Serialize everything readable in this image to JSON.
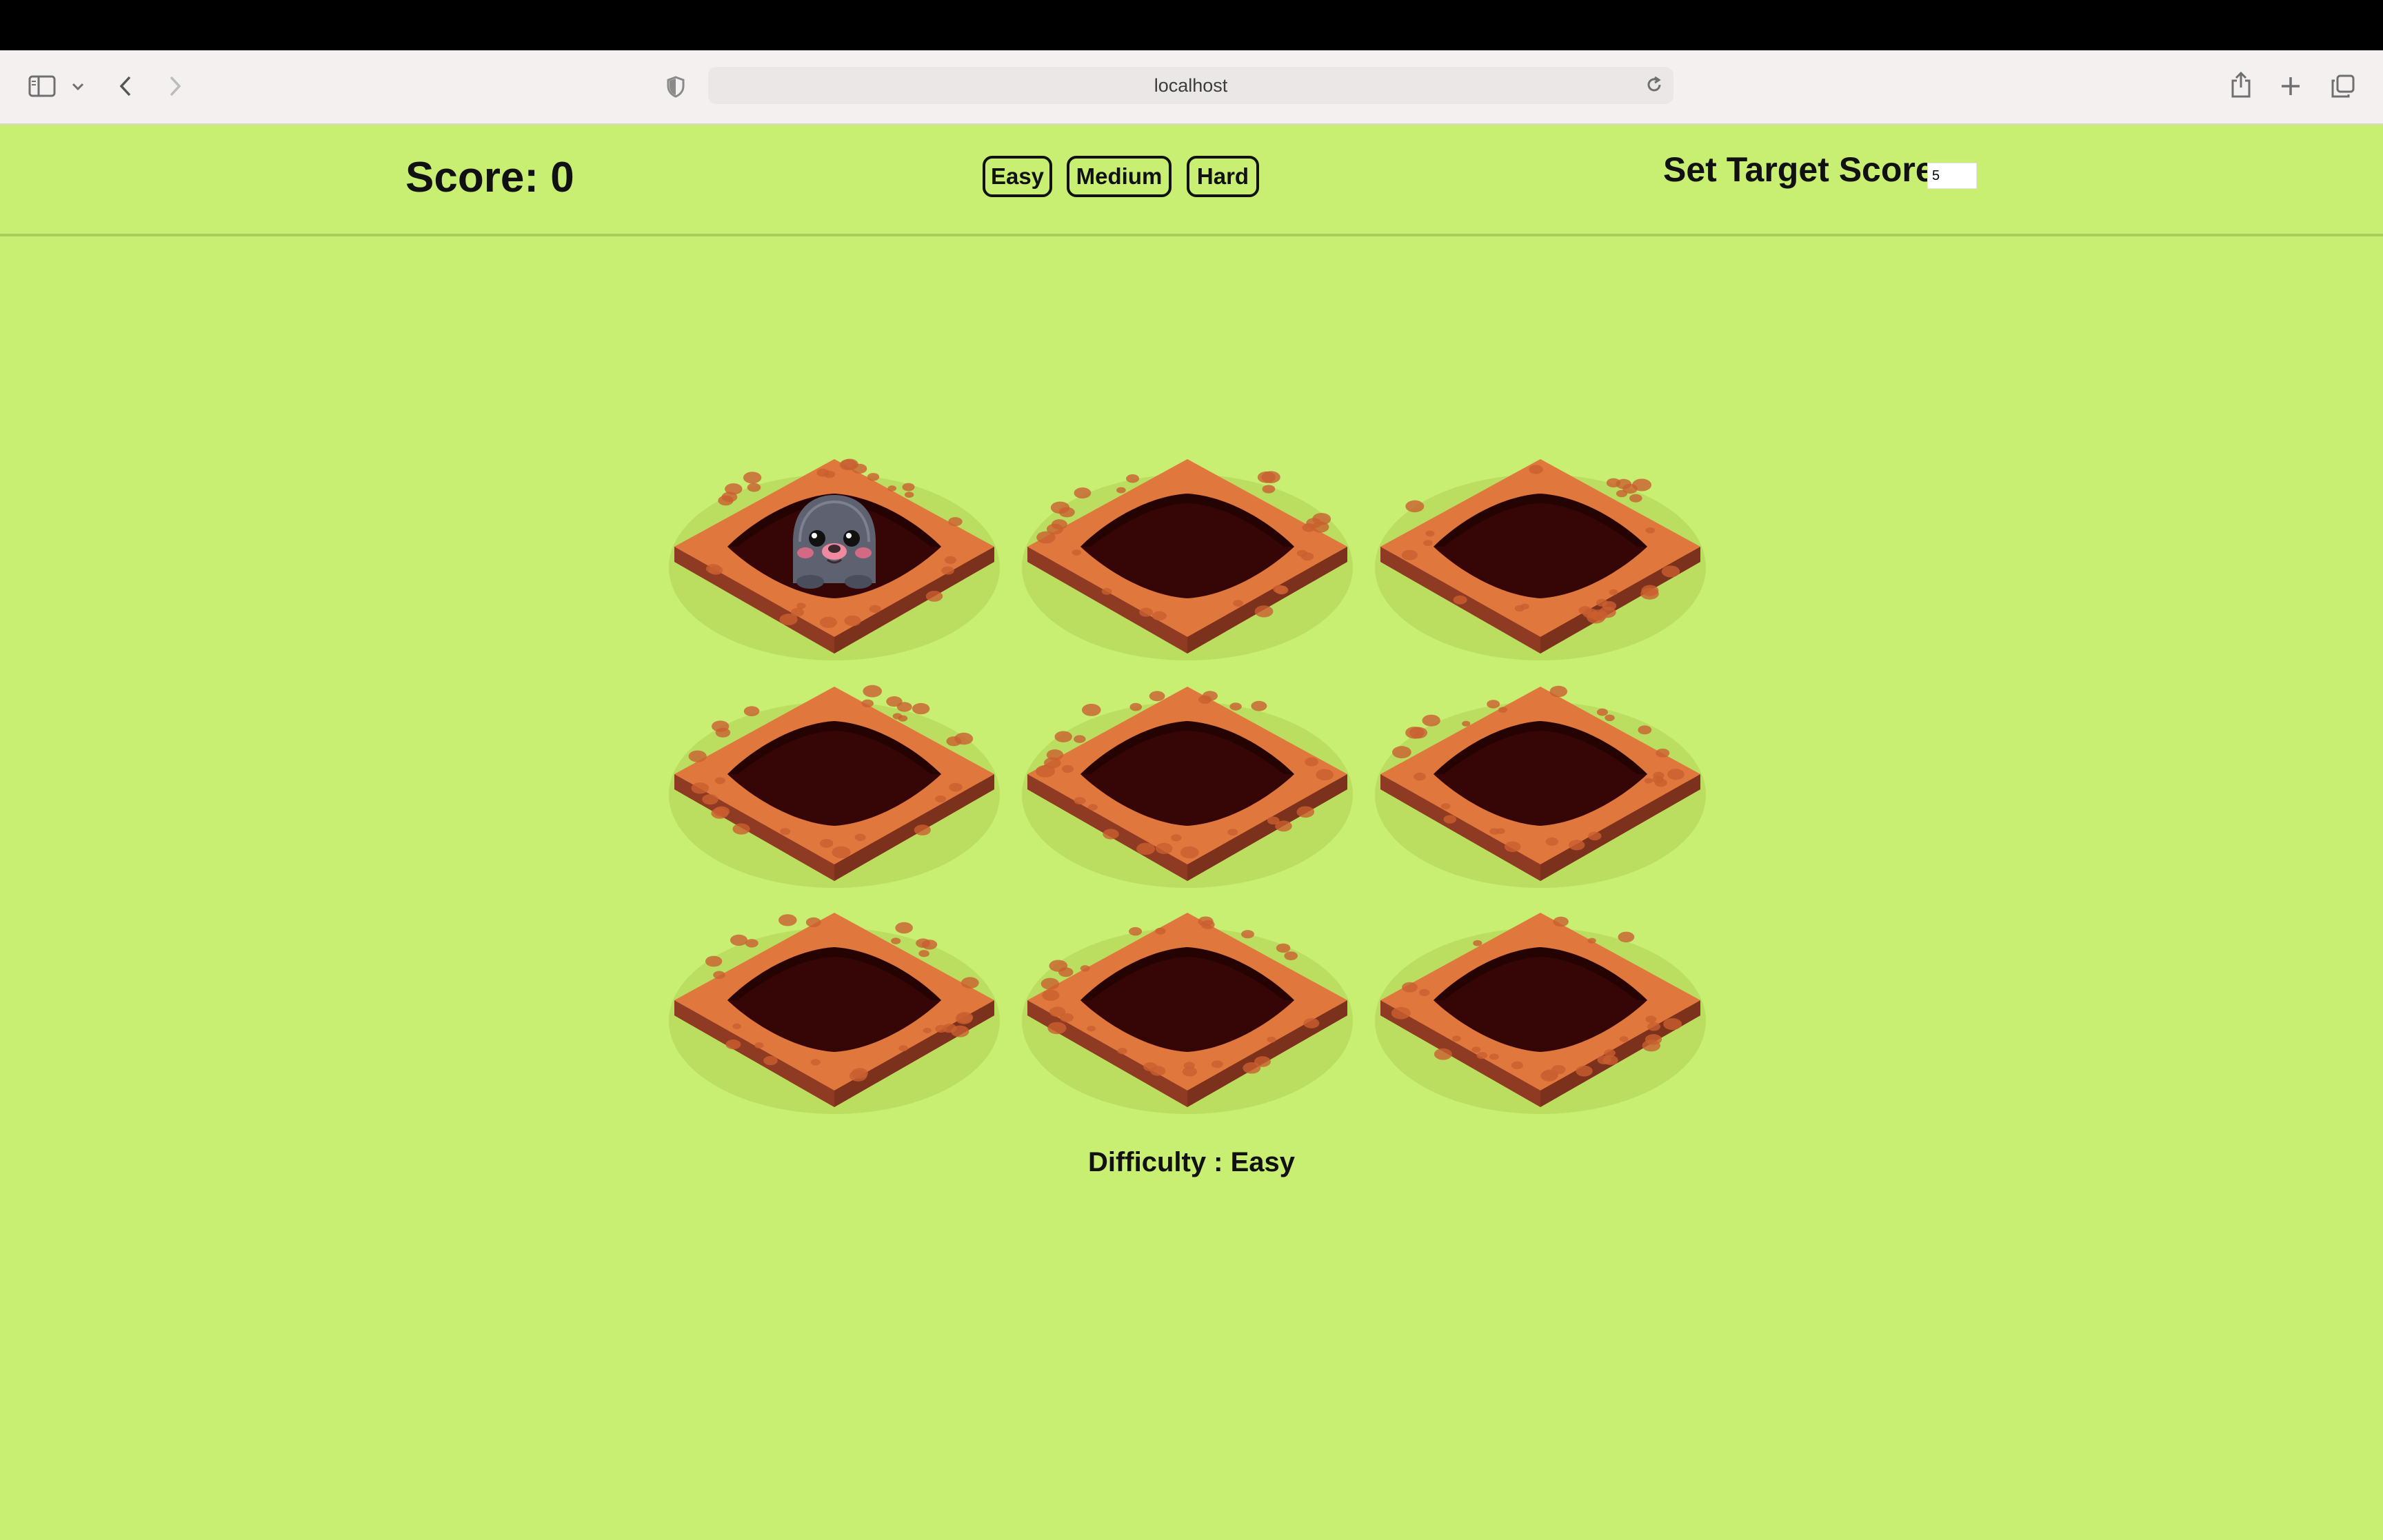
{
  "browser": {
    "url": "localhost"
  },
  "game": {
    "score_label": "Score: 0",
    "score": 0,
    "difficulty_buttons": [
      "Easy",
      "Medium",
      "Hard"
    ],
    "target_label": "Set Target Score:",
    "target_value": "5",
    "difficulty_text": "Difficulty : Easy",
    "holes": [
      {
        "mole": true
      },
      {
        "mole": false
      },
      {
        "mole": false
      },
      {
        "mole": false
      },
      {
        "mole": false
      },
      {
        "mole": false
      },
      {
        "mole": false
      },
      {
        "mole": false
      },
      {
        "mole": false
      }
    ]
  },
  "colors": {
    "background": "#c8ee72",
    "dirt": "#e0773d",
    "dirt_dark": "#a9462a",
    "hole": "#360606",
    "mole": "#5d6170"
  }
}
